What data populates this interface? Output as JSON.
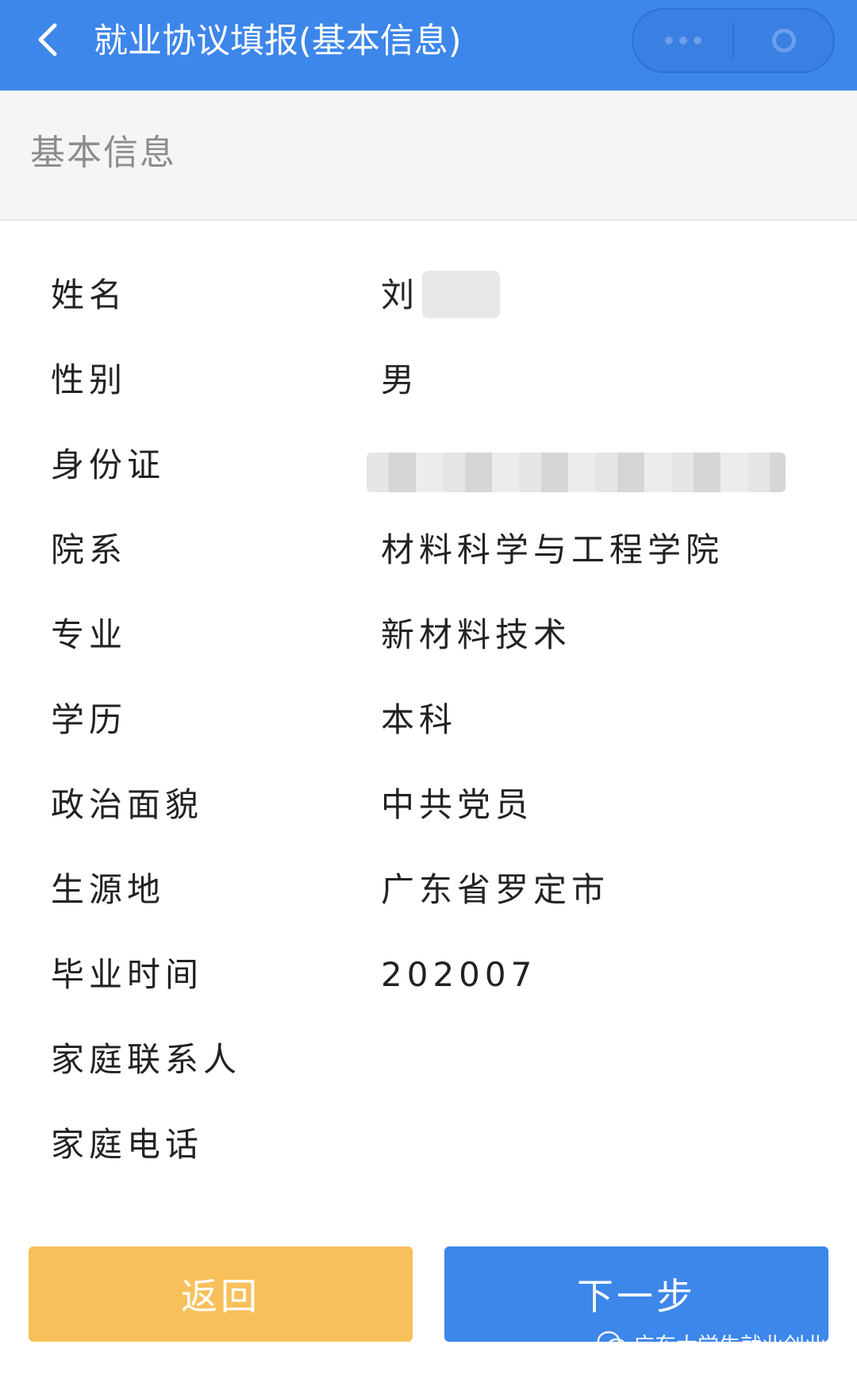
{
  "header": {
    "title": "就业协议填报(基本信息)",
    "back_icon": "chevron-left-icon",
    "menu_icon": "more-dots-icon",
    "close_icon": "close-circle-icon"
  },
  "section": {
    "title": "基本信息"
  },
  "fields": [
    {
      "label": "姓名",
      "value": "刘"
    },
    {
      "label": "性别",
      "value": "男"
    },
    {
      "label": "身份证",
      "value": ""
    },
    {
      "label": "院系",
      "value": "材料科学与工程学院"
    },
    {
      "label": "专业",
      "value": "新材料技术"
    },
    {
      "label": "学历",
      "value": "本科"
    },
    {
      "label": "政治面貌",
      "value": "中共党员"
    },
    {
      "label": "生源地",
      "value": "广东省罗定市"
    },
    {
      "label": "毕业时间",
      "value": "202007"
    },
    {
      "label": "家庭联系人",
      "value": ""
    },
    {
      "label": "家庭电话",
      "value": ""
    }
  ],
  "buttons": {
    "back_label": "返回",
    "next_label": "下一步"
  },
  "watermark": {
    "text": "广东大学生就业创业"
  },
  "colors": {
    "primary": "#3d86ea",
    "back_button": "#f8c05a",
    "section_bg": "#f5f5f5"
  }
}
